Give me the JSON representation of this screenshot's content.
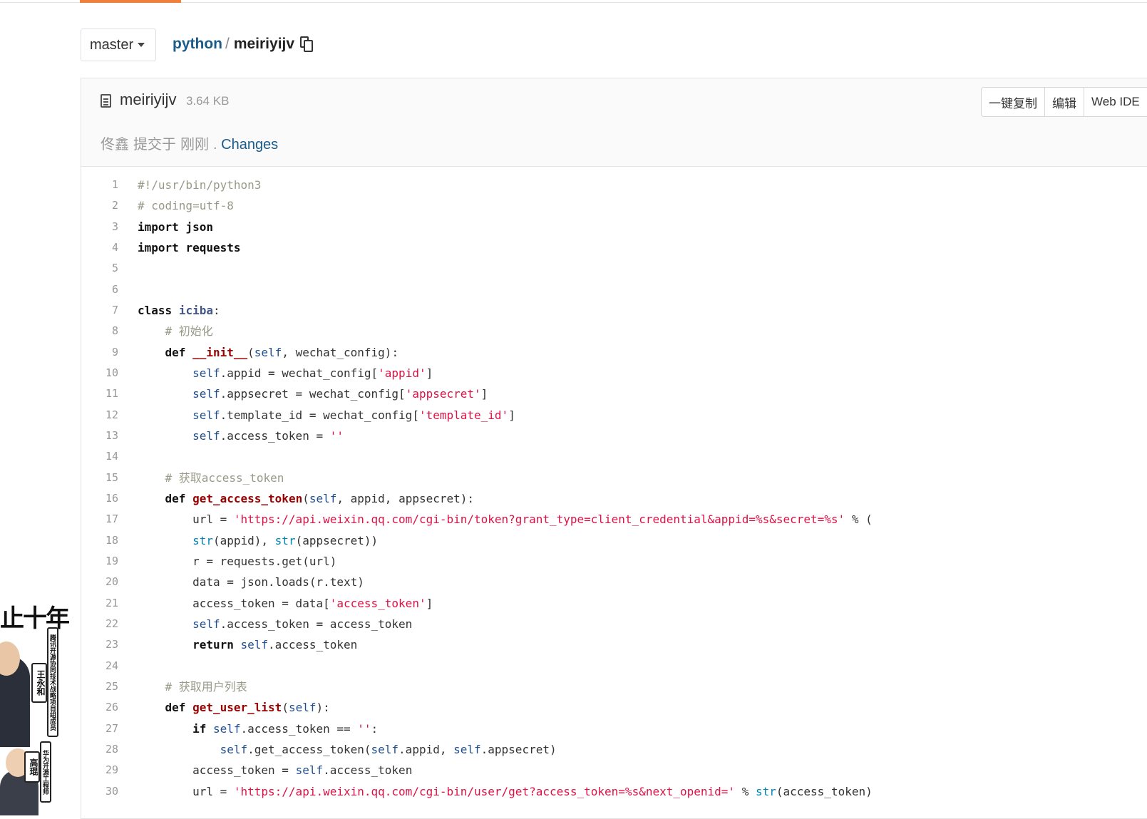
{
  "toolbar": {
    "branch": "master",
    "repo": "python",
    "separator": "/",
    "file": "meiriyijv"
  },
  "file_header": {
    "name": "meiriyijv",
    "size": "3.64 KB",
    "actions": [
      "一键复制",
      "编辑",
      "Web IDE"
    ],
    "commit": {
      "author": "佟鑫",
      "action": "提交于",
      "time": "刚刚",
      "dot": ".",
      "link": "Changes"
    }
  },
  "promo": {
    "title": "止十年",
    "name1": "王永和",
    "role1": "腾讯开源协同技术战略项目组成员",
    "name2": "高琨",
    "role2": "华为开源工程师"
  },
  "colors": {
    "accent": "#f0803c",
    "link": "#1a5b8a",
    "string": "#d14",
    "function": "#990000"
  },
  "code_lines": [
    {
      "n": "1",
      "tokens": [
        [
          "com",
          "#!/usr/bin/python3"
        ]
      ]
    },
    {
      "n": "2",
      "tokens": [
        [
          "com",
          "# coding=utf-8"
        ]
      ]
    },
    {
      "n": "3",
      "tokens": [
        [
          "kw",
          "import"
        ],
        [
          "",
          " "
        ],
        [
          "kw",
          "json"
        ]
      ]
    },
    {
      "n": "4",
      "tokens": [
        [
          "kw",
          "import"
        ],
        [
          "",
          " "
        ],
        [
          "kw",
          "requests"
        ]
      ]
    },
    {
      "n": "5",
      "tokens": []
    },
    {
      "n": "6",
      "tokens": []
    },
    {
      "n": "7",
      "tokens": [
        [
          "kw",
          "class"
        ],
        [
          "",
          " "
        ],
        [
          "cls",
          "iciba"
        ],
        [
          "",
          ":"
        ]
      ]
    },
    {
      "n": "8",
      "tokens": [
        [
          "",
          "    "
        ],
        [
          "com",
          "# 初始化"
        ]
      ]
    },
    {
      "n": "9",
      "tokens": [
        [
          "",
          "    "
        ],
        [
          "kw",
          "def"
        ],
        [
          "",
          " "
        ],
        [
          "fn",
          "__init__"
        ],
        [
          "",
          "("
        ],
        [
          "slf",
          "self"
        ],
        [
          "",
          ", wechat_config):"
        ]
      ]
    },
    {
      "n": "10",
      "tokens": [
        [
          "",
          "        "
        ],
        [
          "slf",
          "self"
        ],
        [
          "",
          ".appid = wechat_config["
        ],
        [
          "str",
          "'appid'"
        ],
        [
          "",
          "]"
        ]
      ]
    },
    {
      "n": "11",
      "tokens": [
        [
          "",
          "        "
        ],
        [
          "slf",
          "self"
        ],
        [
          "",
          ".appsecret = wechat_config["
        ],
        [
          "str",
          "'appsecret'"
        ],
        [
          "",
          "]"
        ]
      ]
    },
    {
      "n": "12",
      "tokens": [
        [
          "",
          "        "
        ],
        [
          "slf",
          "self"
        ],
        [
          "",
          ".template_id = wechat_config["
        ],
        [
          "str",
          "'template_id'"
        ],
        [
          "",
          "]"
        ]
      ]
    },
    {
      "n": "13",
      "tokens": [
        [
          "",
          "        "
        ],
        [
          "slf",
          "self"
        ],
        [
          "",
          ".access_token = "
        ],
        [
          "str",
          "''"
        ]
      ]
    },
    {
      "n": "14",
      "tokens": []
    },
    {
      "n": "15",
      "tokens": [
        [
          "",
          "    "
        ],
        [
          "com",
          "# 获取access_token"
        ]
      ]
    },
    {
      "n": "16",
      "tokens": [
        [
          "",
          "    "
        ],
        [
          "kw",
          "def"
        ],
        [
          "",
          " "
        ],
        [
          "fn",
          "get_access_token"
        ],
        [
          "",
          "("
        ],
        [
          "slf",
          "self"
        ],
        [
          "",
          ", appid, appsecret):"
        ]
      ]
    },
    {
      "n": "17",
      "tokens": [
        [
          "",
          "        url = "
        ],
        [
          "str",
          "'https://api.weixin.qq.com/cgi-bin/token?grant_type=client_credential&appid=%s&secret=%s'"
        ],
        [
          "",
          " % ("
        ]
      ]
    },
    {
      "n": "18",
      "tokens": [
        [
          "",
          "        "
        ],
        [
          "bi",
          "str"
        ],
        [
          "",
          "(appid), "
        ],
        [
          "bi",
          "str"
        ],
        [
          "",
          "(appsecret))"
        ]
      ]
    },
    {
      "n": "19",
      "tokens": [
        [
          "",
          "        r = requests.get(url)"
        ]
      ]
    },
    {
      "n": "20",
      "tokens": [
        [
          "",
          "        data = json.loads(r.text)"
        ]
      ]
    },
    {
      "n": "21",
      "tokens": [
        [
          "",
          "        access_token = data["
        ],
        [
          "str",
          "'access_token'"
        ],
        [
          "",
          "]"
        ]
      ]
    },
    {
      "n": "22",
      "tokens": [
        [
          "",
          "        "
        ],
        [
          "slf",
          "self"
        ],
        [
          "",
          ".access_token = access_token"
        ]
      ]
    },
    {
      "n": "23",
      "tokens": [
        [
          "",
          "        "
        ],
        [
          "kw",
          "return"
        ],
        [
          "",
          " "
        ],
        [
          "slf",
          "self"
        ],
        [
          "",
          ".access_token"
        ]
      ]
    },
    {
      "n": "24",
      "tokens": []
    },
    {
      "n": "25",
      "tokens": [
        [
          "",
          "    "
        ],
        [
          "com",
          "# 获取用户列表"
        ]
      ]
    },
    {
      "n": "26",
      "tokens": [
        [
          "",
          "    "
        ],
        [
          "kw",
          "def"
        ],
        [
          "",
          " "
        ],
        [
          "fn",
          "get_user_list"
        ],
        [
          "",
          "("
        ],
        [
          "slf",
          "self"
        ],
        [
          "",
          "):"
        ]
      ]
    },
    {
      "n": "27",
      "tokens": [
        [
          "",
          "        "
        ],
        [
          "kw",
          "if"
        ],
        [
          "",
          " "
        ],
        [
          "slf",
          "self"
        ],
        [
          "",
          ".access_token == "
        ],
        [
          "str",
          "''"
        ],
        [
          "",
          ":"
        ]
      ]
    },
    {
      "n": "28",
      "tokens": [
        [
          "",
          "            "
        ],
        [
          "slf",
          "self"
        ],
        [
          "",
          ".get_access_token("
        ],
        [
          "slf",
          "self"
        ],
        [
          "",
          ".appid, "
        ],
        [
          "slf",
          "self"
        ],
        [
          "",
          ".appsecret)"
        ]
      ]
    },
    {
      "n": "29",
      "tokens": [
        [
          "",
          "        access_token = "
        ],
        [
          "slf",
          "self"
        ],
        [
          "",
          ".access_token"
        ]
      ]
    },
    {
      "n": "30",
      "tokens": [
        [
          "",
          "        url = "
        ],
        [
          "str",
          "'https://api.weixin.qq.com/cgi-bin/user/get?access_token=%s&next_openid='"
        ],
        [
          "",
          " % "
        ],
        [
          "bi",
          "str"
        ],
        [
          "",
          "(access_token)"
        ]
      ]
    }
  ]
}
